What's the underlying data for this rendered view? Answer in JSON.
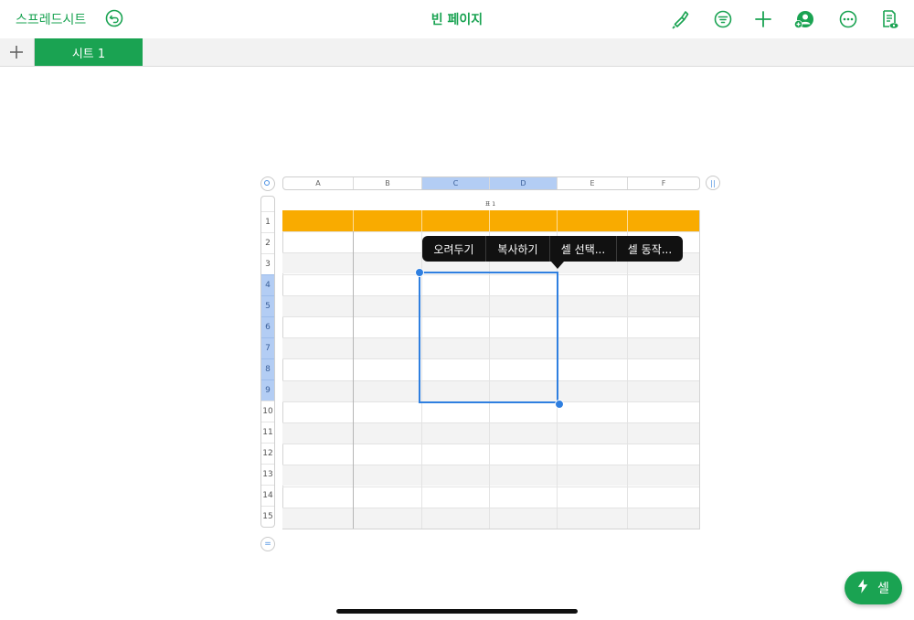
{
  "topbar": {
    "back_label": "스프레드시트",
    "title": "빈 페이지",
    "icons": [
      "undo-icon",
      "paintbrush-icon",
      "filter-icon",
      "add-icon",
      "collaborate-icon",
      "more-icon",
      "document-view-icon"
    ]
  },
  "tabs": {
    "add_icon": "plus-icon",
    "items": [
      {
        "label": "시트 1",
        "active": true
      }
    ]
  },
  "table": {
    "name": "표 1",
    "header_color": "#f9ab00",
    "columns": [
      "A",
      "B",
      "C",
      "D",
      "E",
      "F"
    ],
    "selected_columns": [
      "C",
      "D"
    ],
    "rows": [
      "1",
      "2",
      "3",
      "4",
      "5",
      "6",
      "7",
      "8",
      "9",
      "10",
      "11",
      "12",
      "13",
      "14",
      "15"
    ],
    "selected_rows": [
      "4",
      "5",
      "6",
      "7",
      "8",
      "9"
    ]
  },
  "context_menu": {
    "items": [
      "오려두기",
      "복사하기",
      "셀 선택...",
      "셀 동작..."
    ]
  },
  "cell_button": {
    "label": "셀",
    "icon": "lightning-icon"
  },
  "colors": {
    "accent": "#1aa352",
    "selection": "#2f7fe0",
    "header": "#f9ab00"
  }
}
